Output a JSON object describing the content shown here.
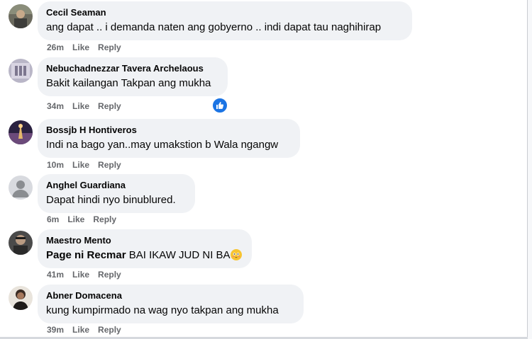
{
  "comments": [
    {
      "author": "Cecil Seaman",
      "text": "ang dapat .. i demanda naten ang gobyerno .. indi dapat tau naghihirap",
      "time": "26m",
      "like": "Like",
      "reply": "Reply"
    },
    {
      "author": "Nebuchadnezzar Tavera Archelaous",
      "text": "Bakit kailangan Takpan ang mukha",
      "time": "34m",
      "like": "Like",
      "reply": "Reply",
      "reaction": "like-reaction"
    },
    {
      "author": "Bossjb H Hontiveros",
      "text": "Indi na bago yan..may umakstion b Wala ngangw",
      "time": "10m",
      "like": "Like",
      "reply": "Reply"
    },
    {
      "author": "Anghel Guardiana",
      "text": "Dapat hindi nyo binublured.",
      "time": "6m",
      "like": "Like",
      "reply": "Reply"
    },
    {
      "author": "Maestro Mento",
      "mention": "Page ni Recmar",
      "text": "BAI IKAW JUD NI BA",
      "emoji": "flushed-face",
      "time": "41m",
      "like": "Like",
      "reply": "Reply"
    },
    {
      "author": "Abner Domacena",
      "text": "kung kumpirmado na wag nyo takpan ang mukha",
      "time": "39m",
      "like": "Like",
      "reply": "Reply"
    }
  ],
  "colors": {
    "bubble": "#f0f2f5",
    "meta": "#65676b",
    "like_blue": "#1b74e4"
  }
}
